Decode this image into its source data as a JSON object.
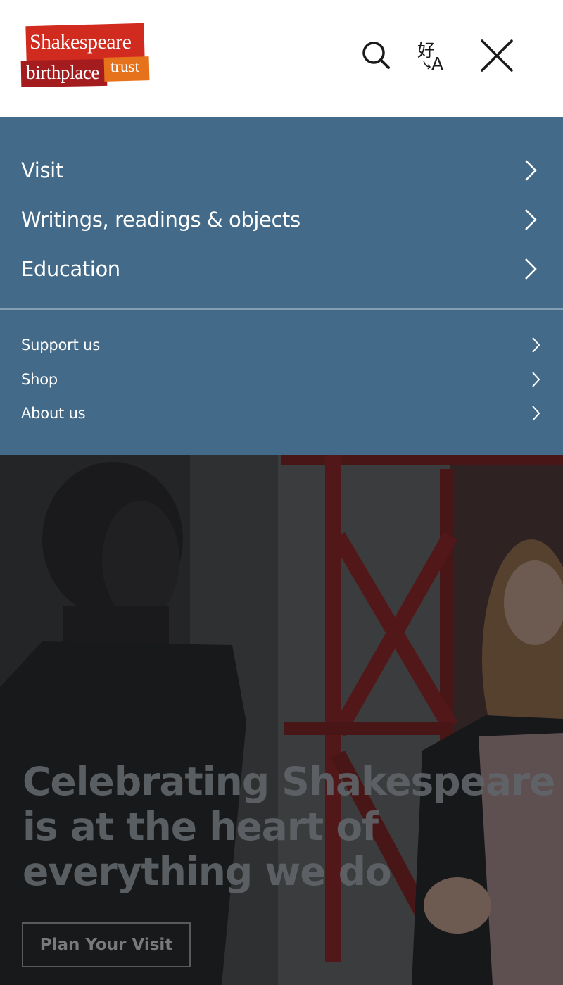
{
  "logo": {
    "line1": "Shakespeare",
    "line2": "birthplace",
    "line3": "trust"
  },
  "header": {
    "icons": [
      "search-icon",
      "translate-icon",
      "close-icon"
    ]
  },
  "nav": {
    "primary": [
      {
        "label": "Visit"
      },
      {
        "label": "Writings, readings & objects"
      },
      {
        "label": "Education"
      }
    ],
    "secondary": [
      {
        "label": "Support us"
      },
      {
        "label": "Shop"
      },
      {
        "label": "About us"
      }
    ]
  },
  "hero": {
    "title_lines": [
      "Celebrating Shakespeare",
      "is at the heart of",
      "everything we do"
    ],
    "cta_label": "Plan Your Visit"
  },
  "colors": {
    "nav_background": "#436a88",
    "logo_red": "#d12a1e",
    "logo_dark_red": "#a51c1f",
    "logo_orange": "#e6731c"
  }
}
